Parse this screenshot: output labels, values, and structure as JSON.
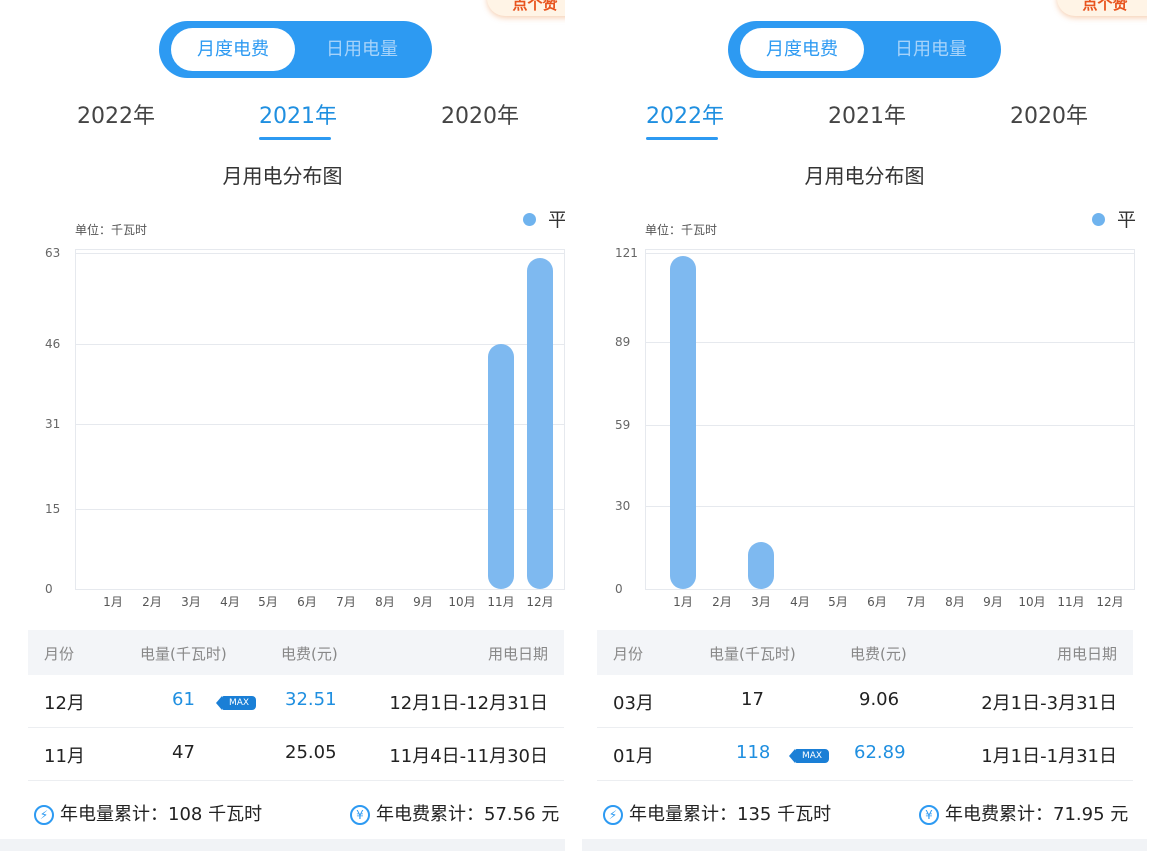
{
  "panels": [
    {
      "corner_badge": "点个赞",
      "toggle": {
        "active": "月度电费",
        "inactive": "日用电量"
      },
      "years": [
        "2022年",
        "2021年",
        "2020年"
      ],
      "active_year_index": 1,
      "chart_title": "月用电分布图",
      "legend": "平",
      "unit": "单位：千瓦时",
      "table": {
        "headers": [
          "月份",
          "电量(千瓦时)",
          "电费(元)",
          "用电日期"
        ],
        "rows": [
          {
            "month": "12月",
            "kwh": "61",
            "max": "MAX",
            "fee": "32.51",
            "dates": "12月1日-12月31日",
            "highlight": true
          },
          {
            "month": "11月",
            "kwh": "47",
            "max": "",
            "fee": "25.05",
            "dates": "11月4日-11月30日",
            "highlight": false
          }
        ]
      },
      "summary": {
        "kwh_icon": "⚡",
        "kwh_text": "年电量累计：108 千瓦时",
        "fee_icon": "¥",
        "fee_text": "年电费累计：57.56 元"
      }
    },
    {
      "corner_badge": "点个赞",
      "toggle": {
        "active": "月度电费",
        "inactive": "日用电量"
      },
      "years": [
        "2022年",
        "2021年",
        "2020年"
      ],
      "active_year_index": 0,
      "chart_title": "月用电分布图",
      "legend": "平",
      "unit": "单位：千瓦时",
      "table": {
        "headers": [
          "月份",
          "电量(千瓦时)",
          "电费(元)",
          "用电日期"
        ],
        "rows": [
          {
            "month": "03月",
            "kwh": "17",
            "max": "",
            "fee": "9.06",
            "dates": "2月1日-3月31日",
            "highlight": false
          },
          {
            "month": "01月",
            "kwh": "118",
            "max": "MAX",
            "fee": "62.89",
            "dates": "1月1日-1月31日",
            "highlight": true
          }
        ]
      },
      "summary": {
        "kwh_icon": "⚡",
        "kwh_text": "年电量累计：135 千瓦时",
        "fee_icon": "¥",
        "fee_text": "年电费累计：71.95 元"
      }
    }
  ],
  "chart_data": [
    {
      "type": "bar",
      "title": "月用电分布图",
      "ylabel": "单位：千瓦时",
      "categories": [
        "1月",
        "2月",
        "3月",
        "4月",
        "5月",
        "6月",
        "7月",
        "8月",
        "9月",
        "10月",
        "11月",
        "12月"
      ],
      "series": [
        {
          "name": "平",
          "values": [
            0,
            0,
            0,
            0,
            0,
            0,
            0,
            0,
            0,
            0,
            46,
            62
          ]
        }
      ],
      "yticks": [
        "0",
        "15",
        "31",
        "46",
        "63"
      ],
      "ylim": [
        0,
        63
      ],
      "grid": true,
      "legend_position": "top-right",
      "bar_color": "#7eb9f0"
    },
    {
      "type": "bar",
      "title": "月用电分布图",
      "ylabel": "单位：千瓦时",
      "categories": [
        "1月",
        "2月",
        "3月",
        "4月",
        "5月",
        "6月",
        "7月",
        "8月",
        "9月",
        "10月",
        "11月",
        "12月"
      ],
      "series": [
        {
          "name": "平",
          "values": [
            120,
            0,
            17,
            0,
            0,
            0,
            0,
            0,
            0,
            0,
            0,
            0
          ]
        }
      ],
      "yticks": [
        "0",
        "30",
        "59",
        "89",
        "121"
      ],
      "ylim": [
        0,
        121
      ],
      "grid": true,
      "legend_position": "top-right",
      "bar_color": "#7eb9f0"
    }
  ]
}
